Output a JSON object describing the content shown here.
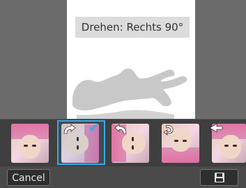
{
  "overlay": {
    "caption": "Drehen: Rechts 90°"
  },
  "strip": {
    "items": [
      {
        "name": "original",
        "icon": "none"
      },
      {
        "name": "rotate-right-90",
        "icon": "rotate-right-icon",
        "selected": true
      },
      {
        "name": "rotate-left-90",
        "icon": "rotate-left-icon"
      },
      {
        "name": "rotate-180",
        "icon": "rotate-180-icon"
      },
      {
        "name": "flip",
        "icon": "flip-icon"
      }
    ]
  },
  "bottom": {
    "cancel_label": "Cancel",
    "save_icon": "save-icon"
  },
  "colors": {
    "accent": "#3aa8e8",
    "background": "#6b6b6b"
  }
}
